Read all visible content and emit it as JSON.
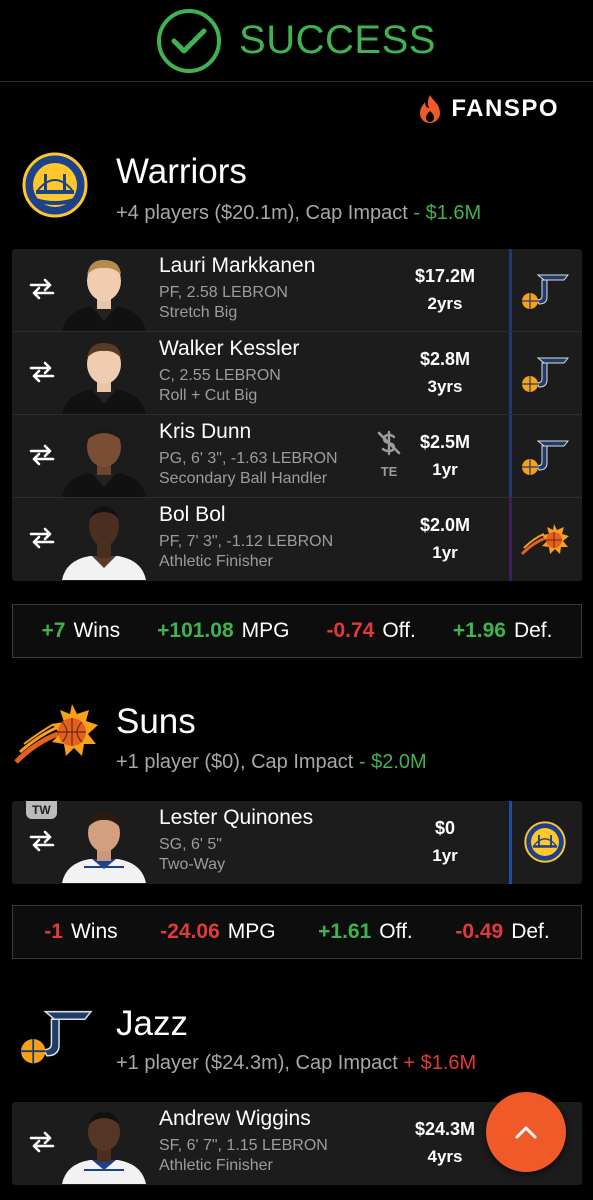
{
  "banner": {
    "text": "SUCCESS"
  },
  "brand": {
    "name": "FANSPO"
  },
  "teams": [
    {
      "name": "Warriors",
      "summary": "+4 players ($20.1m), Cap Impact",
      "impact_sign": " - ",
      "impact_value": "$1.6M",
      "players": [
        {
          "name": "Lauri Markkanen",
          "line1": "PF, 2.58 LEBRON",
          "line2": "Stretch Big",
          "salary": "$17.2M",
          "years": "2yrs",
          "to_team": "jazz"
        },
        {
          "name": "Walker Kessler",
          "line1": "C, 2.55 LEBRON",
          "line2": "Roll + Cut Big",
          "salary": "$2.8M",
          "years": "3yrs",
          "to_team": "jazz"
        },
        {
          "name": "Kris Dunn",
          "line1": "PG, 6' 3\", -1.63 LEBRON",
          "line2": "Secondary Ball Handler",
          "salary": "$2.5M",
          "years": "1yr",
          "to_team": "jazz",
          "badge": "TE"
        },
        {
          "name": "Bol Bol",
          "line1": "PF, 7' 3\", -1.12 LEBRON",
          "line2": "Athletic Finisher",
          "salary": "$2.0M",
          "years": "1yr",
          "to_team": "suns"
        }
      ],
      "stats": [
        {
          "value": "+7",
          "label": "Wins"
        },
        {
          "value": "+101.08",
          "label": "MPG"
        },
        {
          "value": "-0.74",
          "label": "Off."
        },
        {
          "value": "+1.96",
          "label": "Def."
        }
      ]
    },
    {
      "name": "Suns",
      "summary": "+1 player ($0), Cap Impact",
      "impact_sign": " - ",
      "impact_value": "$2.0M",
      "players": [
        {
          "name": "Lester Quinones",
          "line1": "SG, 6' 5\"",
          "line2": "Two-Way",
          "salary": "$0",
          "years": "1yr",
          "to_team": "warriors",
          "tag": "TW"
        }
      ],
      "stats": [
        {
          "value": "-1",
          "label": "Wins"
        },
        {
          "value": "-24.06",
          "label": "MPG"
        },
        {
          "value": "+1.61",
          "label": "Off."
        },
        {
          "value": "-0.49",
          "label": "Def."
        }
      ]
    },
    {
      "name": "Jazz",
      "summary": "+1 player ($24.3m), Cap Impact",
      "impact_sign": " + ",
      "impact_value": "$1.6M",
      "players": [
        {
          "name": "Andrew Wiggins",
          "line1": "SF, 6' 7\", 1.15 LEBRON",
          "line2": "Athletic Finisher",
          "salary": "$24.3M",
          "years": "4yrs",
          "to_team": "warriors"
        }
      ]
    }
  ],
  "colors": {
    "success": "#3fb34f",
    "positive": "#3fb34f",
    "negative": "#e03b3b",
    "fab": "#f05a28",
    "warriors_blue": "#1d428a",
    "warriors_gold": "#ffc72c",
    "jazz_navy": "#002b5c",
    "suns_orange": "#e56020"
  },
  "icons": [
    "check-circle-icon",
    "fanspo-flame-icon",
    "swap-arrows-icon",
    "no-money-icon",
    "chevron-up-icon"
  ]
}
